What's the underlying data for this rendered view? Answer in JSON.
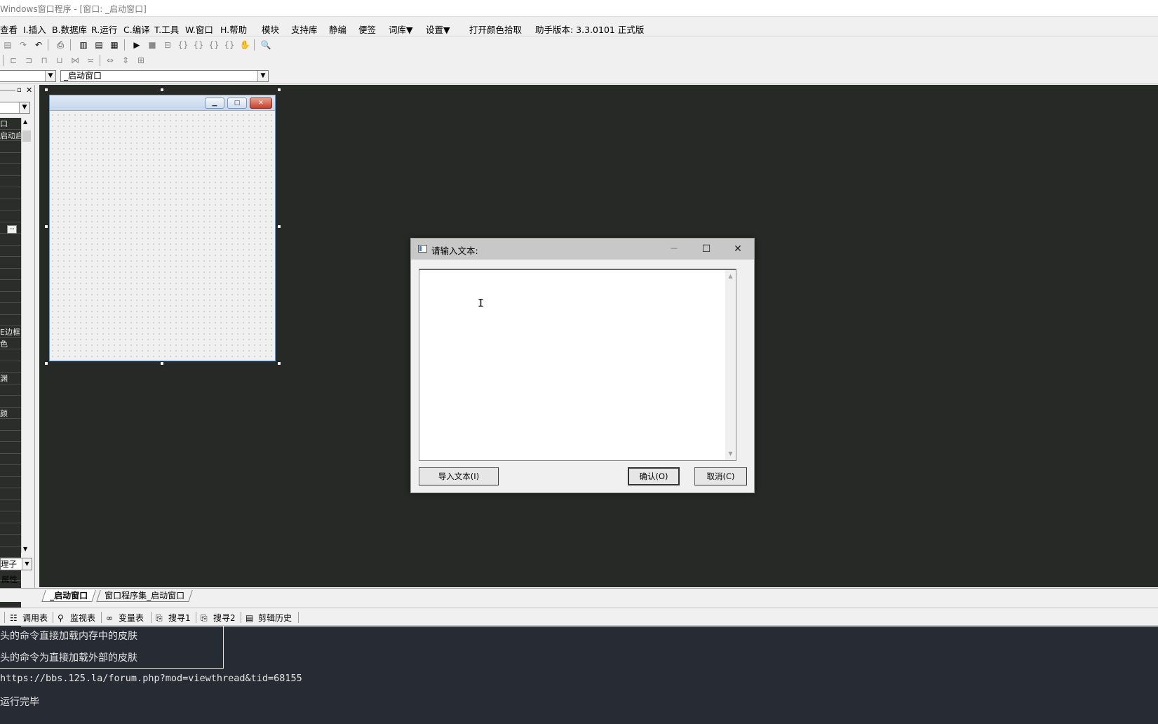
{
  "window": {
    "title": "Windows窗口程序 - [窗口: _启动窗口]"
  },
  "menubar": {
    "items": [
      {
        "label": "查看"
      },
      {
        "label": "I.插入"
      },
      {
        "label": "B.数据库"
      },
      {
        "label": "R.运行"
      },
      {
        "label": "C.编译"
      },
      {
        "label": "T.工具"
      },
      {
        "label": "W.窗口"
      },
      {
        "label": "H.帮助"
      },
      {
        "label": "模块"
      },
      {
        "label": "支持库"
      },
      {
        "label": "静编"
      },
      {
        "label": "便签"
      },
      {
        "label": "词库▼"
      },
      {
        "label": "设置▼"
      },
      {
        "label": "打开颜色拾取"
      },
      {
        "label": "助手版本: 3.3.0101 正式版"
      }
    ]
  },
  "combos": {
    "object_value": "",
    "window_value": "_启动窗口"
  },
  "property_panel": {
    "rows": [
      "口",
      "启动启",
      "",
      "",
      "",
      "",
      "",
      "",
      "",
      "",
      "",
      "",
      "",
      "",
      "",
      "",
      "",
      "",
      "E边框",
      "色",
      "",
      "",
      "渊",
      "",
      "",
      "颜",
      "",
      "",
      "",
      "",
      "",
      "",
      "",
      "",
      "",
      "",
      "",
      "",
      "",
      ""
    ],
    "footer_combo": "理子",
    "footer_label": "属性"
  },
  "design_form": {
    "title": ""
  },
  "dialog": {
    "title": "请输入文本:",
    "text_value": "",
    "import_button": "导入文本(I)",
    "ok_button": "确认(O)",
    "cancel_button": "取消(C)"
  },
  "tabs": [
    {
      "label": "_启动窗口",
      "active": true
    },
    {
      "label": "窗口程序集_启动窗口",
      "active": false
    }
  ],
  "bottom_toolbar": {
    "items": [
      {
        "label": "调用表",
        "icon": "call-table-icon"
      },
      {
        "label": "监视表",
        "icon": "magnifier-icon"
      },
      {
        "label": "变量表",
        "icon": "variables-icon"
      },
      {
        "label": "搜寻1",
        "icon": "search-doc-icon"
      },
      {
        "label": "搜寻2",
        "icon": "search-doc-icon"
      },
      {
        "label": "剪辑历史",
        "icon": "clipboard-icon"
      }
    ]
  },
  "output": {
    "lines": [
      "头的命令直接加载内存中的皮肤",
      "头的命令为直接加载外部的皮肤",
      "https://bbs.125.la/forum.php?mod=viewthread&tid=68155",
      "运行完毕"
    ]
  },
  "colors": {
    "design_background": "#262925",
    "output_background": "#262b34",
    "dialog_title_bar": "#c8c8c8"
  }
}
